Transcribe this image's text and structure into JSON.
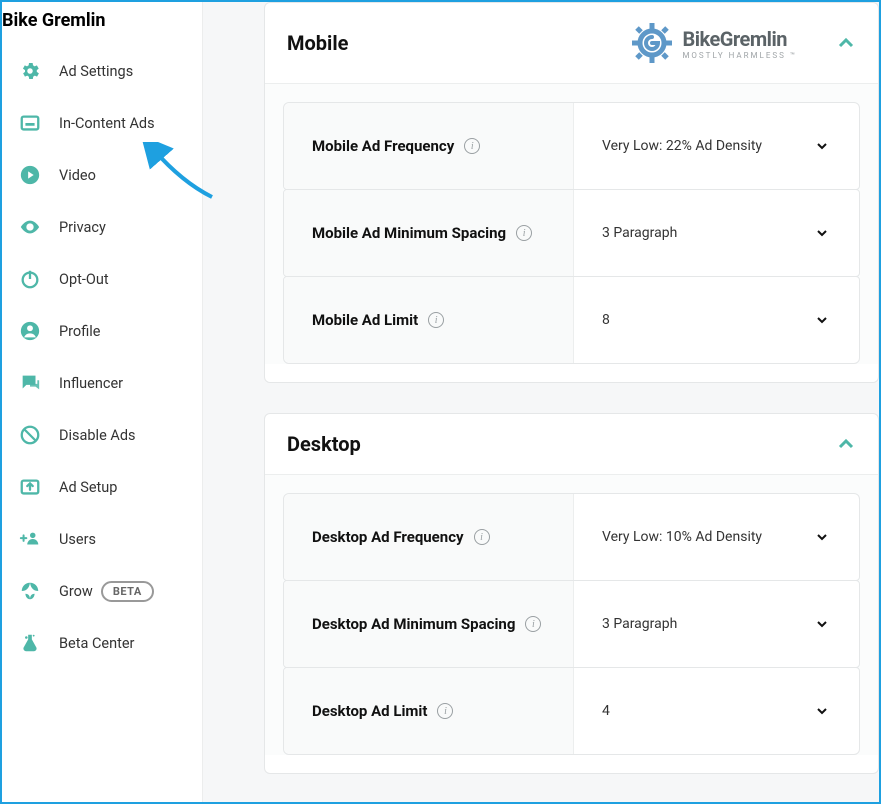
{
  "site_title": "Bike Gremlin",
  "sidebar": {
    "items": [
      {
        "label": "Ad Settings",
        "icon": "settings-gear-icon"
      },
      {
        "label": "In-Content Ads",
        "icon": "content-box-icon"
      },
      {
        "label": "Video",
        "icon": "play-circle-icon"
      },
      {
        "label": "Privacy",
        "icon": "eye-icon"
      },
      {
        "label": "Opt-Out",
        "icon": "power-icon"
      },
      {
        "label": "Profile",
        "icon": "user-circle-icon"
      },
      {
        "label": "Influencer",
        "icon": "chat-icon"
      },
      {
        "label": "Disable Ads",
        "icon": "blocked-icon"
      },
      {
        "label": "Ad Setup",
        "icon": "export-box-icon"
      },
      {
        "label": "Users",
        "icon": "users-add-icon"
      },
      {
        "label": "Grow",
        "icon": "leaf-icon",
        "badge": "BETA"
      },
      {
        "label": "Beta Center",
        "icon": "flask-icon"
      }
    ]
  },
  "brand": {
    "name": "BikeGremlin",
    "tagline": "MOSTLY HARMLESS ™"
  },
  "panels": {
    "mobile": {
      "title": "Mobile",
      "settings": [
        {
          "label": "Mobile Ad Frequency",
          "value": "Very Low: 22% Ad Density"
        },
        {
          "label": "Mobile Ad Minimum Spacing",
          "value": "3 Paragraph"
        },
        {
          "label": "Mobile Ad Limit",
          "value": "8"
        }
      ]
    },
    "desktop": {
      "title": "Desktop",
      "settings": [
        {
          "label": "Desktop Ad Frequency",
          "value": "Very Low: 10% Ad Density"
        },
        {
          "label": "Desktop Ad Minimum Spacing",
          "value": "3 Paragraph"
        },
        {
          "label": "Desktop Ad Limit",
          "value": "4"
        }
      ]
    }
  }
}
